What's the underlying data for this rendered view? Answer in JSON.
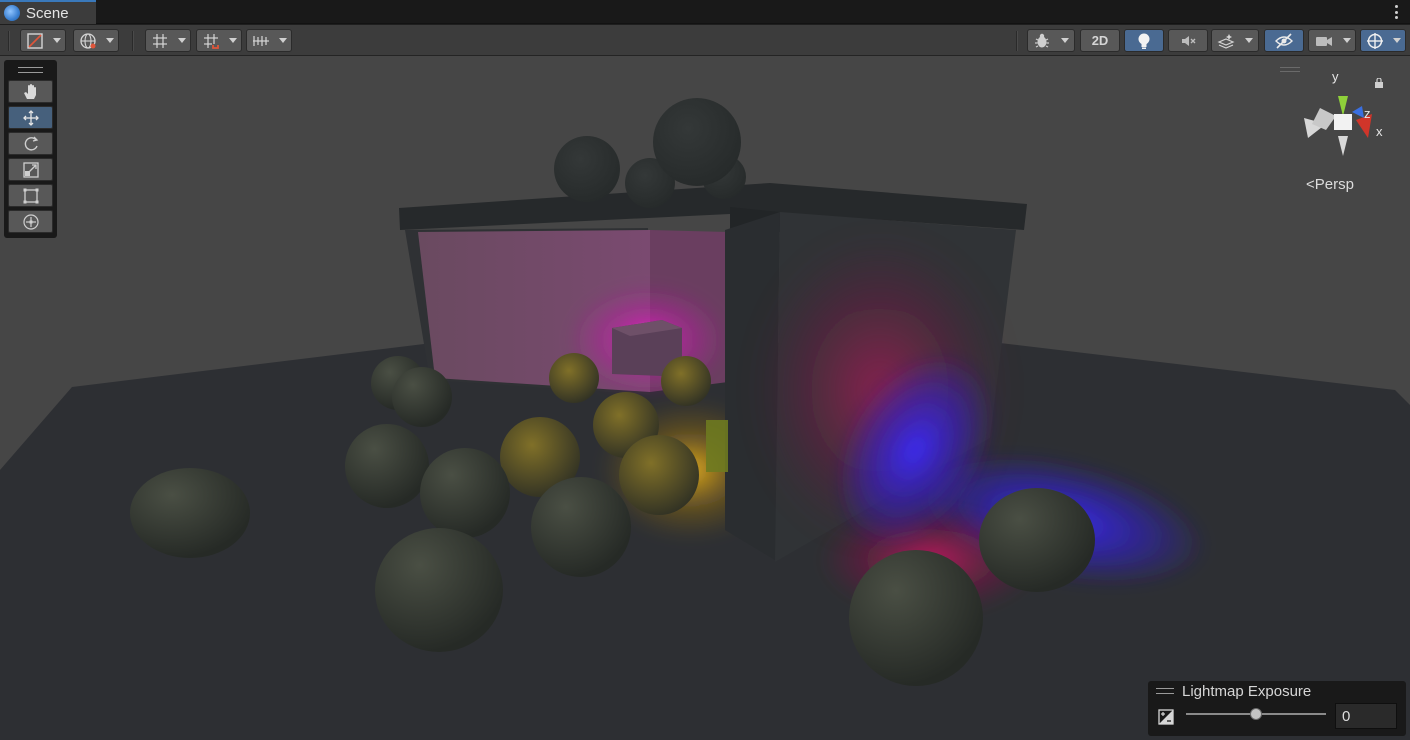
{
  "tab": {
    "title": "Scene",
    "icon": "scene-icon"
  },
  "toolbar": {
    "left": [
      {
        "name": "draw-mode-dropdown",
        "icon": "draw-mode-icon"
      },
      {
        "name": "global-local-dropdown",
        "icon": "globe-icon"
      },
      {
        "name": "grid-visibility-dropdown",
        "icon": "grid-icon"
      },
      {
        "name": "grid-snapping-dropdown",
        "icon": "snap-grid-icon"
      },
      {
        "name": "increment-snapping-dropdown",
        "icon": "ruler-icon"
      }
    ],
    "right": {
      "debug_icon": "debug-icon",
      "toggle_2d_label": "2D",
      "lighting_icon": "lightbulb-icon",
      "audio_icon": "audio-mute-icon",
      "effects_icon": "effects-icon",
      "visibility_icon": "hidden-eye-icon",
      "camera_icon": "camera-icon",
      "gizmos_icon": "gizmo-icon"
    }
  },
  "tools": [
    {
      "name": "hand-tool",
      "icon": "hand-icon",
      "active": false
    },
    {
      "name": "move-tool",
      "icon": "move-icon",
      "active": true
    },
    {
      "name": "rotate-tool",
      "icon": "rotate-icon",
      "active": false
    },
    {
      "name": "scale-tool",
      "icon": "scale-icon",
      "active": false
    },
    {
      "name": "rect-tool",
      "icon": "rect-icon",
      "active": false
    },
    {
      "name": "transform-tool",
      "icon": "transform-icon",
      "active": false
    }
  ],
  "gizmo": {
    "y_label": "y",
    "z_label": "z",
    "x_label": "x",
    "projection_label": "Persp"
  },
  "lightmap": {
    "title": "Lightmap Exposure",
    "value": "0",
    "slider_fraction": 0.5
  },
  "colors": {
    "accent": "#3a79bb",
    "active_tool": "#46607c",
    "magenta_light": "#ff1fd0",
    "blue_light": "#3a22ff",
    "yellow_light": "#ffc21a",
    "axis_y": "#8fd13a",
    "axis_x": "#d0352a",
    "axis_z": "#3a6fe0"
  }
}
